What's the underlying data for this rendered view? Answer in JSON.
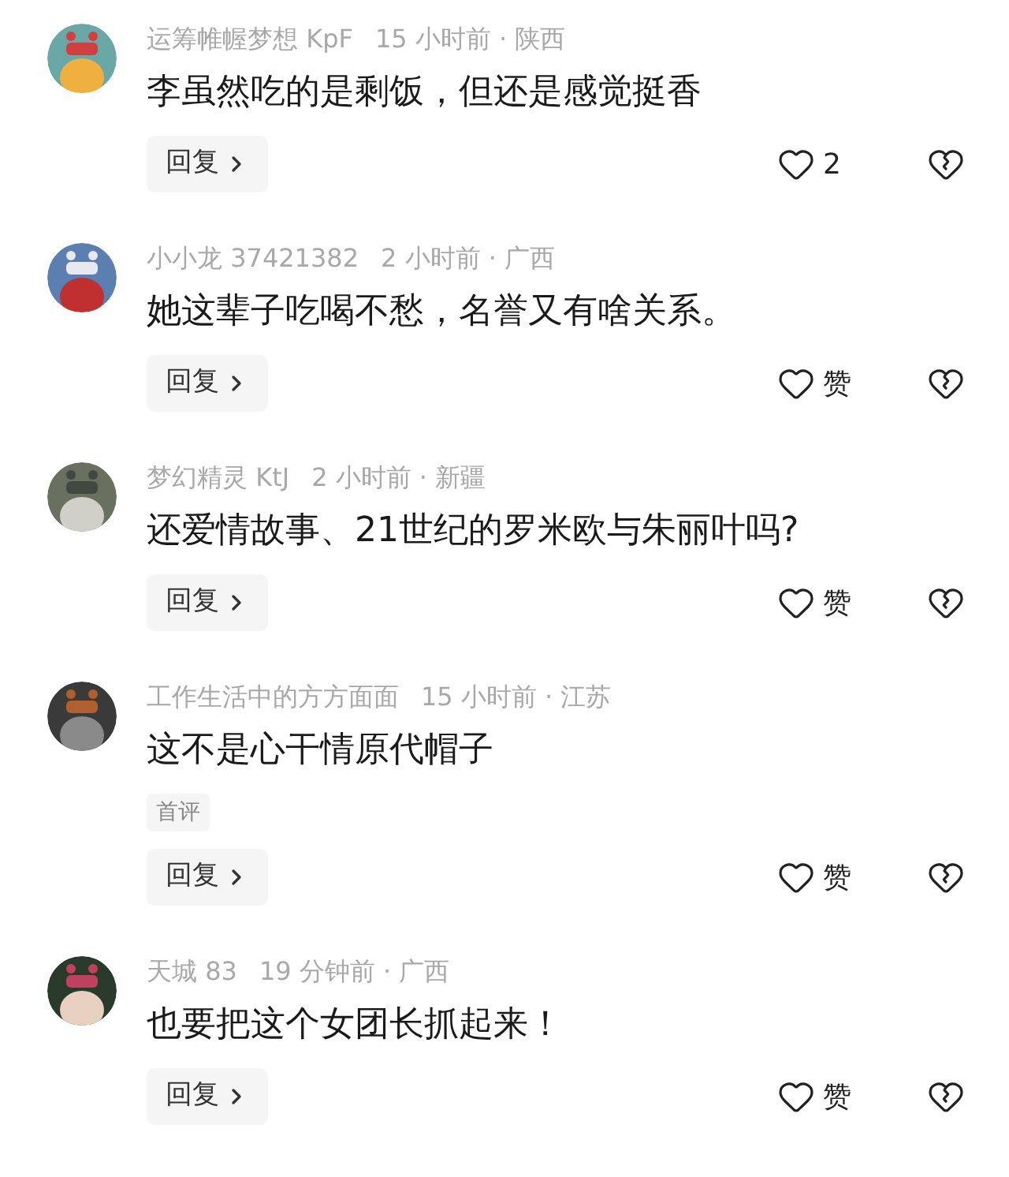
{
  "comments": [
    {
      "user": "运筹帷幄梦想 KpF",
      "meta": "15 小时前 · 陕西",
      "text": "李虽然吃的是剩饭，但还是感觉挺香",
      "reply": "回复",
      "likes": "2"
    },
    {
      "user": "小小龙 37421382",
      "meta": "2 小时前 · 广西",
      "text": "她这辈子吃喝不愁，名誉又有啥关系。",
      "reply": "回复",
      "likes": "赞"
    },
    {
      "user": "梦幻精灵 KtJ",
      "meta": "2 小时前 · 新疆",
      "text": "还爱情故事、21世纪的罗米欧与朱丽叶吗?",
      "reply": "回复",
      "likes": "赞"
    },
    {
      "user": "工作生活中的方方面面",
      "meta": "15 小时前 · 江苏",
      "text": "这不是心干情原代帽子",
      "tag": "首评",
      "reply": "回复",
      "likes": "赞"
    },
    {
      "user": "天城 83",
      "meta": "19 分钟前 · 广西",
      "text": "也要把这个女团长抓起来！",
      "reply": "回复",
      "likes": "赞"
    }
  ]
}
